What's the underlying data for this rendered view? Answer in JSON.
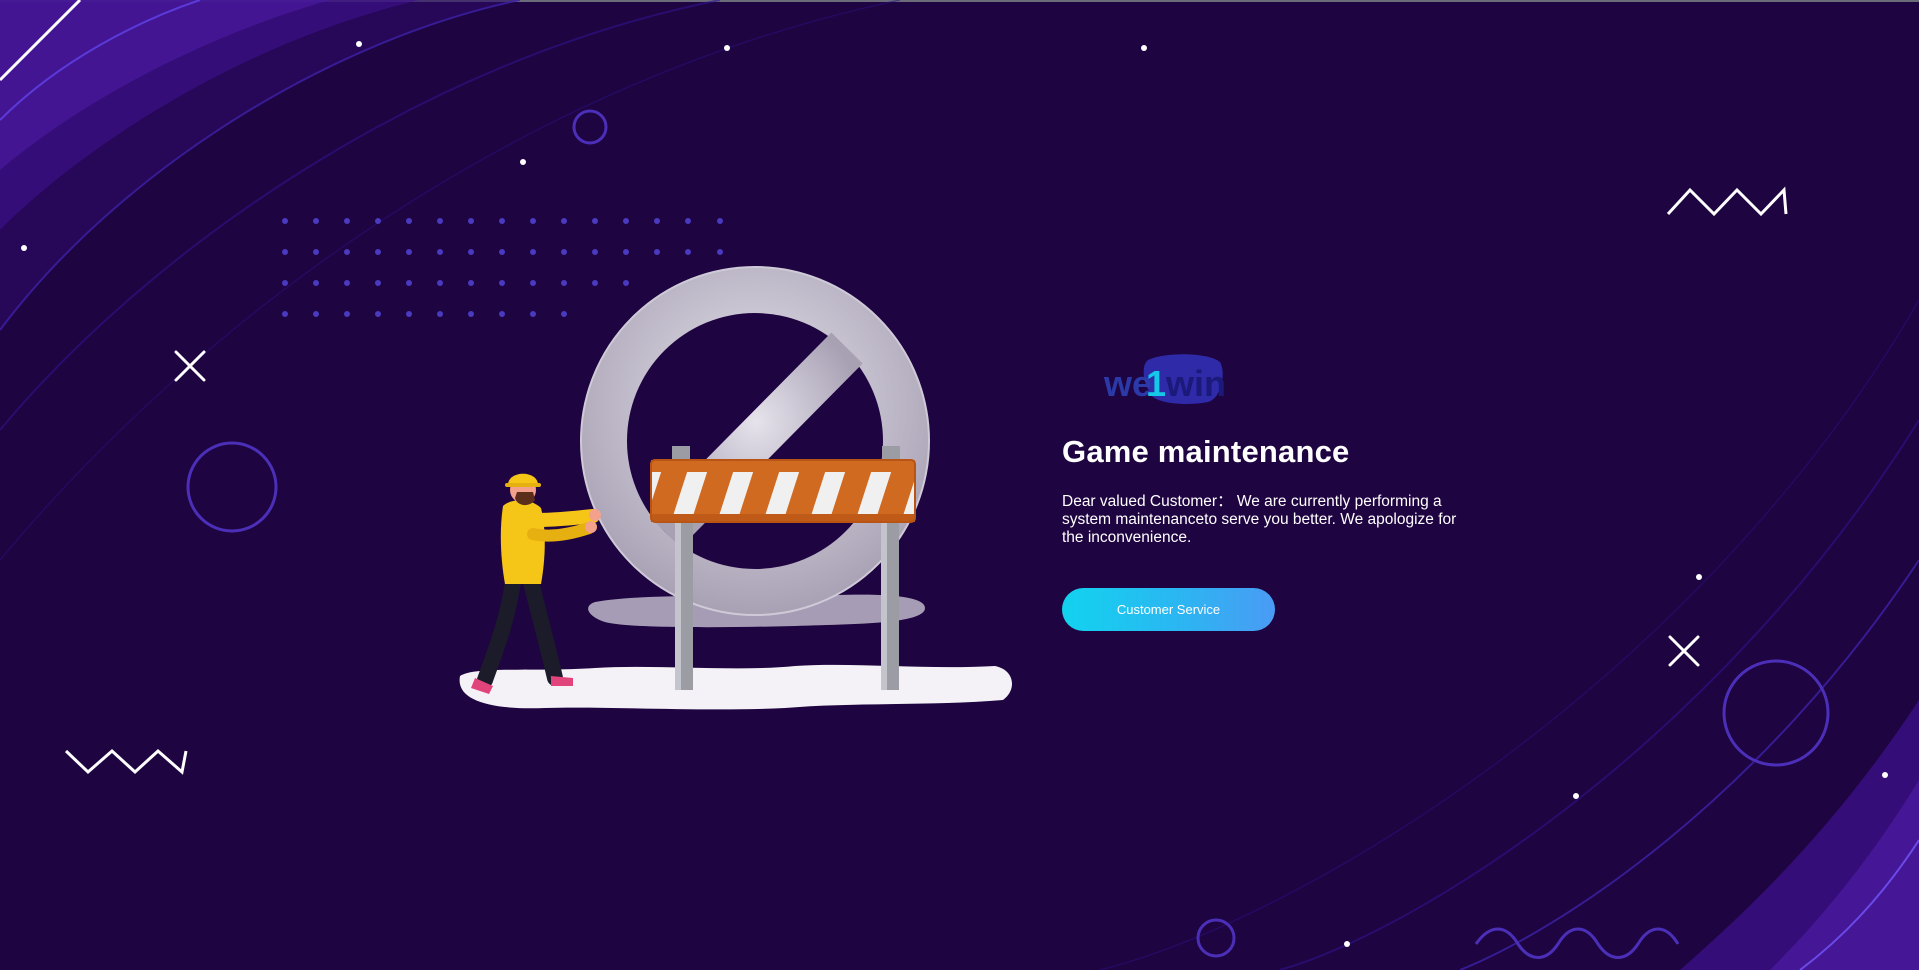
{
  "brand": {
    "logo_text_prefix": "we",
    "logo_text_digit": "1",
    "logo_text_suffix": "win",
    "logo_icon": "we1win-logo"
  },
  "content": {
    "title": "Game maintenance",
    "message": "Dear valued Customer： We are currently performing a system maintenanceto serve you better. We apologize for the inconvenience.",
    "customer_service_label": "Customer Service"
  },
  "illustration": {
    "icon": "maintenance-worker-barrier-illustration"
  },
  "colors": {
    "background": "#1e0440",
    "accent_purple": "#4b2fb8",
    "button_gradient_start": "#12d3ee",
    "button_gradient_end": "#4a9bf4",
    "barrier_orange": "#d2691e",
    "worker_yellow": "#f5c518"
  }
}
